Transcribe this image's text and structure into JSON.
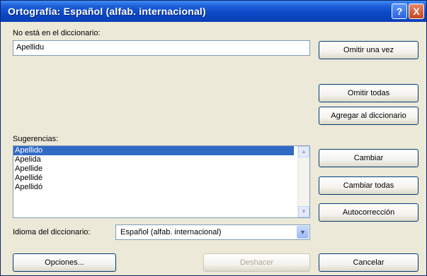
{
  "window": {
    "title": "Ortografía: Español (alfab. internacional)",
    "help_glyph": "?",
    "close_glyph": "X"
  },
  "not_in_dict": {
    "label": "No está en el diccionario:",
    "value": "Apellidu"
  },
  "buttons": {
    "ignore_once": "Omitir una vez",
    "ignore_all": "Omitir todas",
    "add_to_dict": "Agregar al diccionario",
    "change": "Cambiar",
    "change_all": "Cambiar todas",
    "autocorrect": "Autocorrección",
    "options": "Opciones...",
    "undo": "Deshacer",
    "cancel": "Cancelar"
  },
  "suggestions": {
    "label": "Sugerencias:",
    "items": [
      "Apellido",
      "Apelida",
      "Apellide",
      "Apellidé",
      "Apellidó"
    ],
    "selected_index": 0
  },
  "dict_language": {
    "label": "Idioma del diccionario:",
    "value": "Español (alfab. internacional)"
  },
  "icons": {
    "scroll_up": "▲",
    "scroll_down": "▼",
    "dropdown": "▼"
  },
  "colors": {
    "title_bar": "#0b48c6",
    "selection": "#316ac5",
    "dialog_bg": "#ece9d8"
  }
}
